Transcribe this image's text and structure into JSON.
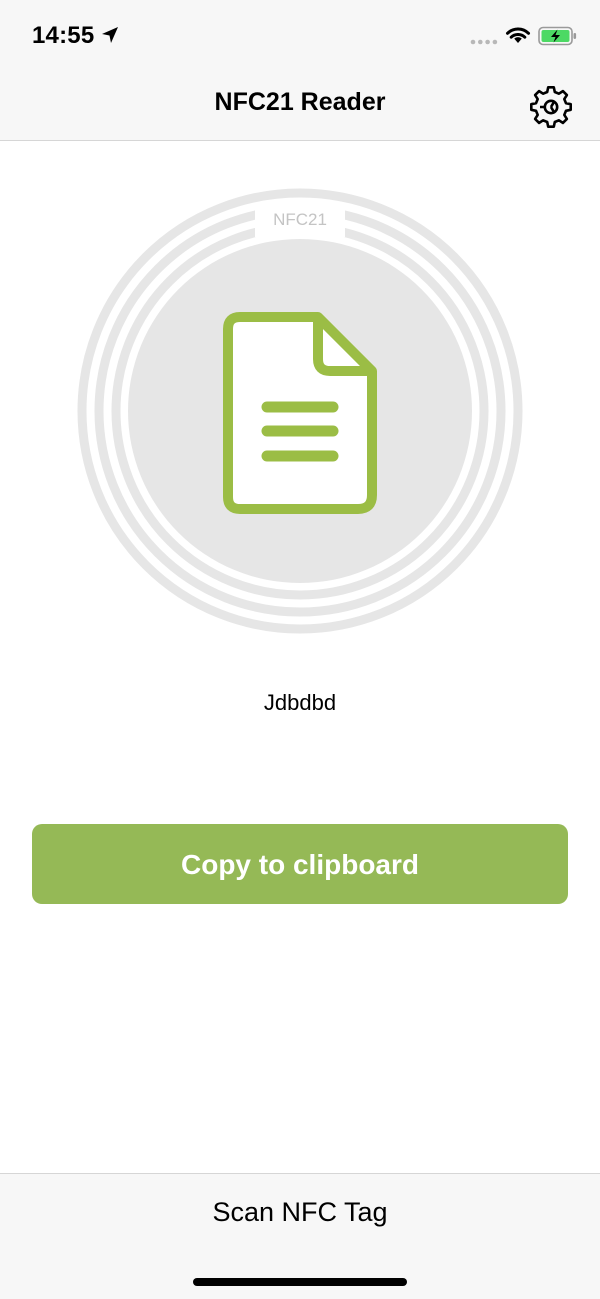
{
  "status_bar": {
    "time": "14:55",
    "icons": [
      "location-arrow-icon",
      "signal-dots-icon",
      "wifi-icon",
      "battery-charging-icon"
    ]
  },
  "nav": {
    "title": "NFC21 Reader",
    "settings_icon": "gear-icon"
  },
  "graphic": {
    "label": "NFC21",
    "icon": "document-icon",
    "accent_color": "#9bbd45"
  },
  "tag": {
    "content": "Jdbdbd"
  },
  "actions": {
    "copy_label": "Copy to clipboard",
    "copy_color": "#95b956"
  },
  "bottom_bar": {
    "scan_label": "Scan NFC Tag"
  }
}
